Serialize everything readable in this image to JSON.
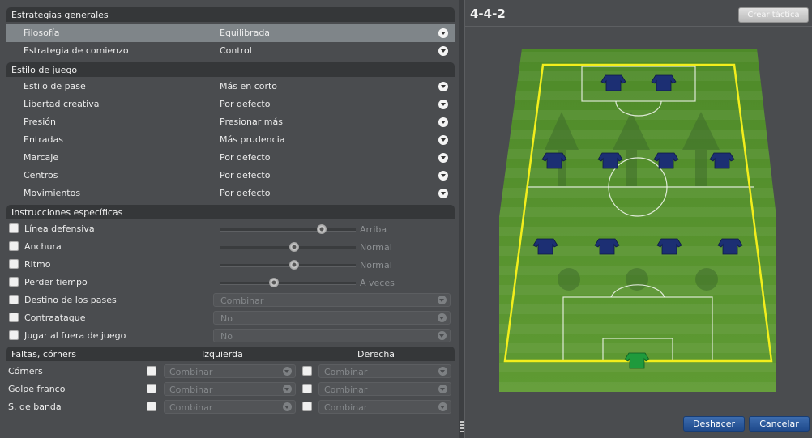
{
  "general": {
    "section_title": "Estrategias generales",
    "rows": [
      {
        "label": "Filosofía",
        "value": "Equilibrada"
      },
      {
        "label": "Estrategia de comienzo",
        "value": "Control"
      }
    ]
  },
  "style": {
    "section_title": "Estilo de juego",
    "rows": [
      {
        "label": "Estilo de pase",
        "value": "Más en corto"
      },
      {
        "label": "Libertad creativa",
        "value": "Por defecto"
      },
      {
        "label": "Presión",
        "value": "Presionar más"
      },
      {
        "label": "Entradas",
        "value": "Más prudencia"
      },
      {
        "label": "Marcaje",
        "value": "Por defecto"
      },
      {
        "label": "Centros",
        "value": "Por defecto"
      },
      {
        "label": "Movimientos",
        "value": "Por defecto"
      }
    ]
  },
  "instructions": {
    "section_title": "Instrucciones específicas",
    "sliders": [
      {
        "label": "Línea defensiva",
        "value_label": "Arriba",
        "level": 0.75
      },
      {
        "label": "Anchura",
        "value_label": "Normal",
        "level": 0.55
      },
      {
        "label": "Ritmo",
        "value_label": "Normal",
        "level": 0.55
      },
      {
        "label": "Perder tiempo",
        "value_label": "A veces",
        "level": 0.4
      }
    ],
    "dropdowns": [
      {
        "label": "Destino de los pases",
        "value": "Combinar"
      },
      {
        "label": "Contraataque",
        "value": "No"
      },
      {
        "label": "Jugar al fuera de juego",
        "value": "No"
      }
    ]
  },
  "setpieces": {
    "header": "Faltas, córners",
    "left_header": "Izquierda",
    "right_header": "Derecha",
    "rows": [
      {
        "label": "Córners",
        "left": "Combinar",
        "right": "Combinar"
      },
      {
        "label": "Golpe franco",
        "left": "Combinar",
        "right": "Combinar"
      },
      {
        "label": "S. de banda",
        "left": "Combinar",
        "right": "Combinar"
      }
    ]
  },
  "formation": {
    "title": "4-4-2",
    "create_label": "Crear táctica"
  },
  "buttons": {
    "undo": "Deshacer",
    "cancel": "Cancelar"
  },
  "colors": {
    "pitch_green": "#4f8a2b",
    "box_yellow": "#f2ee1c",
    "shirt_blue": "#1c2f73",
    "keeper_green": "#1f9a3c",
    "button_blue": "#2a5a9e"
  }
}
